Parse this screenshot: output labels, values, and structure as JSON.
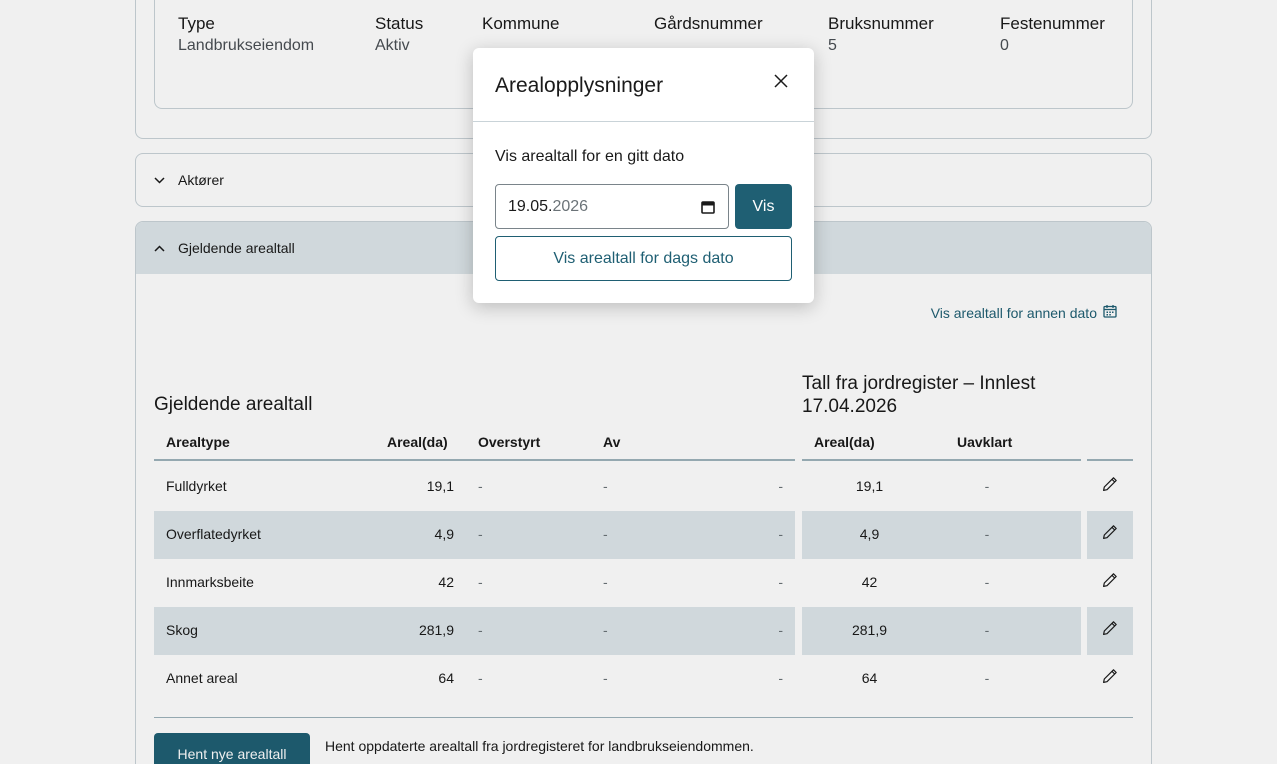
{
  "property": {
    "columns": [
      {
        "label": "Type",
        "value": "Landbrukseiendom"
      },
      {
        "label": "Status",
        "value": "Aktiv"
      },
      {
        "label": "Kommune",
        "value": ""
      },
      {
        "label": "Gårdsnummer",
        "value": ""
      },
      {
        "label": "Bruksnummer",
        "value": "5"
      },
      {
        "label": "Festenummer",
        "value": "0"
      }
    ]
  },
  "aktorer": {
    "label": "Aktører"
  },
  "arealtall": {
    "header": "Gjeldende arealtall",
    "annen_dato_link": "Vis arealtall for annen dato",
    "section_title": "Gjeldende arealtall",
    "jord_title": "Tall fra jordregister – Innlest 17.04.2026",
    "columns": {
      "arealtype": "Arealtype",
      "areal": "Areal(da)",
      "overstyrt": "Overstyrt",
      "av": "Av",
      "jord_areal": "Areal(da)",
      "uavklart": "Uavklart"
    },
    "rows": [
      {
        "type": "Fulldyrket",
        "areal": "19,1",
        "overstyrt": "-",
        "av": "-",
        "extra": "-",
        "jord_areal": "19,1",
        "uavklart": "-"
      },
      {
        "type": "Overflatedyrket",
        "areal": "4,9",
        "overstyrt": "-",
        "av": "-",
        "extra": "-",
        "jord_areal": "4,9",
        "uavklart": "-"
      },
      {
        "type": "Innmarksbeite",
        "areal": "42",
        "overstyrt": "-",
        "av": "-",
        "extra": "-",
        "jord_areal": "42",
        "uavklart": "-"
      },
      {
        "type": "Skog",
        "areal": "281,9",
        "overstyrt": "-",
        "av": "-",
        "extra": "-",
        "jord_areal": "281,9",
        "uavklart": "-"
      },
      {
        "type": "Annet areal",
        "areal": "64",
        "overstyrt": "-",
        "av": "-",
        "extra": "-",
        "jord_areal": "64",
        "uavklart": "-"
      }
    ],
    "hent_button": "Hent nye arealtall",
    "hent_text": "Hent oppdaterte arealtall fra jordregisteret for landbrukseiendommen."
  },
  "modal": {
    "title": "Arealopplysninger",
    "label": "Vis arealtall for en gitt dato",
    "date_daymonth": "19.05.",
    "date_year": "2026",
    "vis_button": "Vis",
    "dags_button": "Vis arealtall for dags dato"
  },
  "icons": {
    "close": "close-icon",
    "calendar": "calendar-icon",
    "edit": "pencil-icon",
    "chevron_down": "chevron-down-icon",
    "chevron_up": "chevron-up-icon"
  },
  "colors": {
    "accent": "#1f5f73",
    "row_alt": "#dde6ea",
    "border": "#c9d3d8"
  }
}
